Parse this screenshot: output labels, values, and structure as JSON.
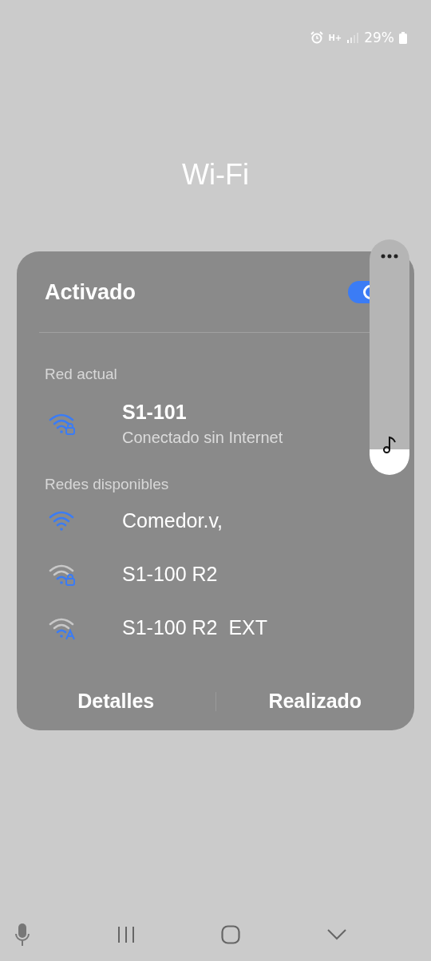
{
  "status_bar": {
    "network": "H+",
    "battery": "29%"
  },
  "title": "Wi-Fi",
  "wifi": {
    "label": "Activado",
    "on": true
  },
  "current_section": "Red actual",
  "current_network": {
    "name": "S1-101",
    "status": "Conectado sin Internet",
    "weak": false,
    "kind": "lock"
  },
  "available_section": "Redes disponibles",
  "networks": [
    {
      "name": "Comedor.v,",
      "weak": false,
      "kind": "open"
    },
    {
      "name": "S1-100 R2",
      "weak": true,
      "kind": "lock"
    },
    {
      "name": "S1-100 R2  EXT",
      "weak": true,
      "kind": "auto"
    }
  ],
  "buttons": [
    "Detalles",
    "Realizado"
  ]
}
